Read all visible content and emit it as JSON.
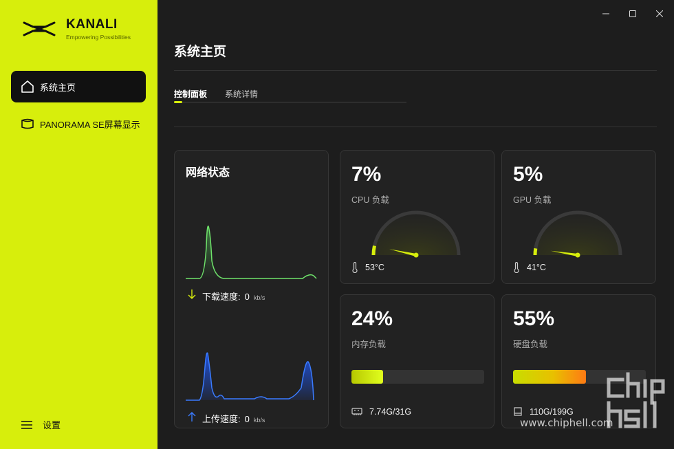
{
  "brand": {
    "name": "KANALI",
    "tagline": "Empowering Possibilities",
    "accent": "#d7ee0c"
  },
  "sidebar": {
    "items": [
      {
        "label": "系统主页",
        "icon": "home-icon",
        "active": true
      },
      {
        "label": "PANORAMA SE屏幕显示",
        "icon": "display-icon",
        "active": false
      }
    ],
    "settings_label": "设置"
  },
  "window_controls": [
    "minimize-icon",
    "maximize-icon",
    "close-icon"
  ],
  "main": {
    "title": "系统主页",
    "tabs": [
      {
        "label": "控制面板",
        "active": true
      },
      {
        "label": "系统详情",
        "active": false
      }
    ]
  },
  "network": {
    "title": "网络状态",
    "download_label": "下载速度:",
    "download_value": "0",
    "download_unit": "kb/s",
    "upload_label": "上传速度:",
    "upload_value": "0",
    "upload_unit": "kb/s"
  },
  "cpu": {
    "percent_text": "7%",
    "percent": 7,
    "label": "CPU 负载",
    "temp": "53°C"
  },
  "gpu": {
    "percent_text": "5%",
    "percent": 5,
    "label": "GPU 负载",
    "temp": "41°C"
  },
  "memory": {
    "percent_text": "24%",
    "percent": 24,
    "label": "内存负载",
    "usage": "7.74G/31G"
  },
  "disk": {
    "percent_text": "55%",
    "percent": 55,
    "label": "硬盘负载",
    "usage": "110G/199G"
  },
  "watermark": {
    "site": "www.chiphell.com"
  }
}
